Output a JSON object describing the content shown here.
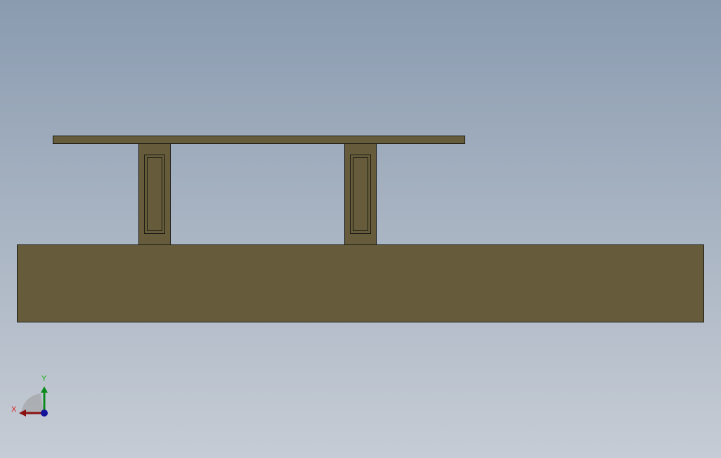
{
  "model": {
    "colors": {
      "part_fill": "#665c3b",
      "edge": "#1a1a12",
      "background_top": "#8a9bb0",
      "background_bottom": "#c6ccd5"
    },
    "parts": [
      "base-plate",
      "top-plate",
      "support-left",
      "support-right"
    ]
  },
  "triad": {
    "x_label": "X",
    "y_label": "Y",
    "colors": {
      "x_axis": "#8b1010",
      "y_axis": "#0c8a1e",
      "z_axis": "#14149a",
      "plane": "#9a9a9a",
      "x_label": "#d42020",
      "y_label": "#18b018"
    }
  }
}
